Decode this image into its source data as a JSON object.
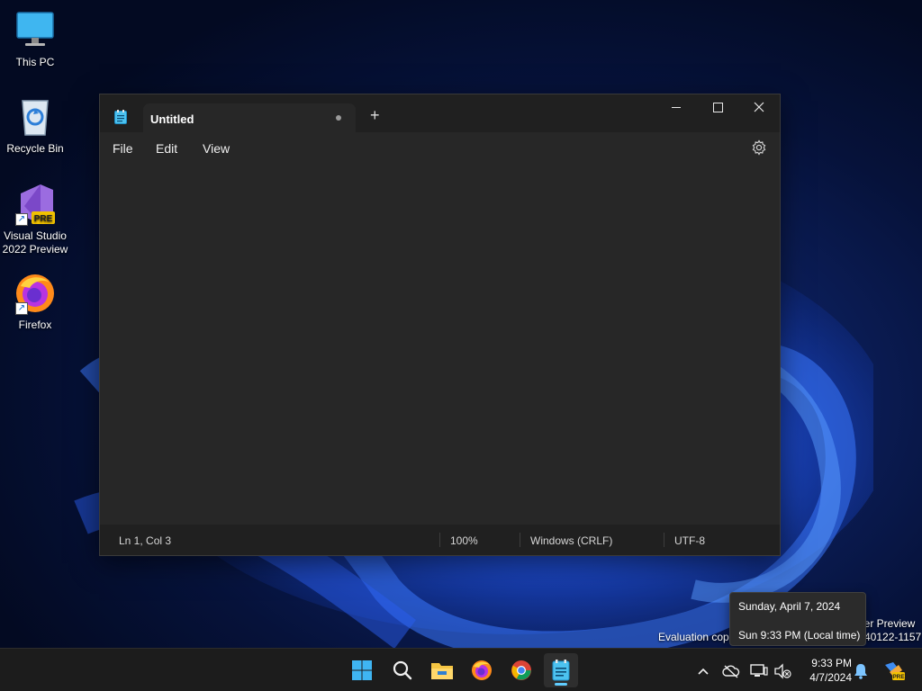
{
  "desktop": {
    "icons": [
      {
        "label": "This PC"
      },
      {
        "label": "Recycle Bin"
      },
      {
        "label_line1": "Visual Studio",
        "label_line2": "2022 Preview",
        "badge": "PRE"
      },
      {
        "label": "Firefox"
      }
    ],
    "watermark": {
      "line1_partial": "ler Preview",
      "line2_left": "Evaluation cop",
      "line2_right": "40122-1157"
    }
  },
  "notepad": {
    "tab_title": "Untitled",
    "new_tab_glyph": "+",
    "menu": [
      "File",
      "Edit",
      "View"
    ],
    "editor_text": "",
    "status": {
      "position": "Ln 1, Col 3",
      "zoom": "100%",
      "line_ending": "Windows (CRLF)",
      "encoding": "UTF-8"
    }
  },
  "tooltip": {
    "date_long": "Sunday, April 7, 2024",
    "time_local": "Sun 9:33 PM (Local time)"
  },
  "taskbar": {
    "pinned": [
      "start-icon",
      "search-icon",
      "file-explorer-icon",
      "firefox-icon",
      "chrome-icon",
      "notepad-icon"
    ],
    "clock_time": "9:33 PM",
    "clock_date": "4/7/2024",
    "tray_badge": "PRE"
  },
  "colors": {
    "accent": "#60cdff",
    "window_bg": "#272727",
    "titlebar_bg": "#202020",
    "taskbar_bg": "#1c1c1c"
  }
}
